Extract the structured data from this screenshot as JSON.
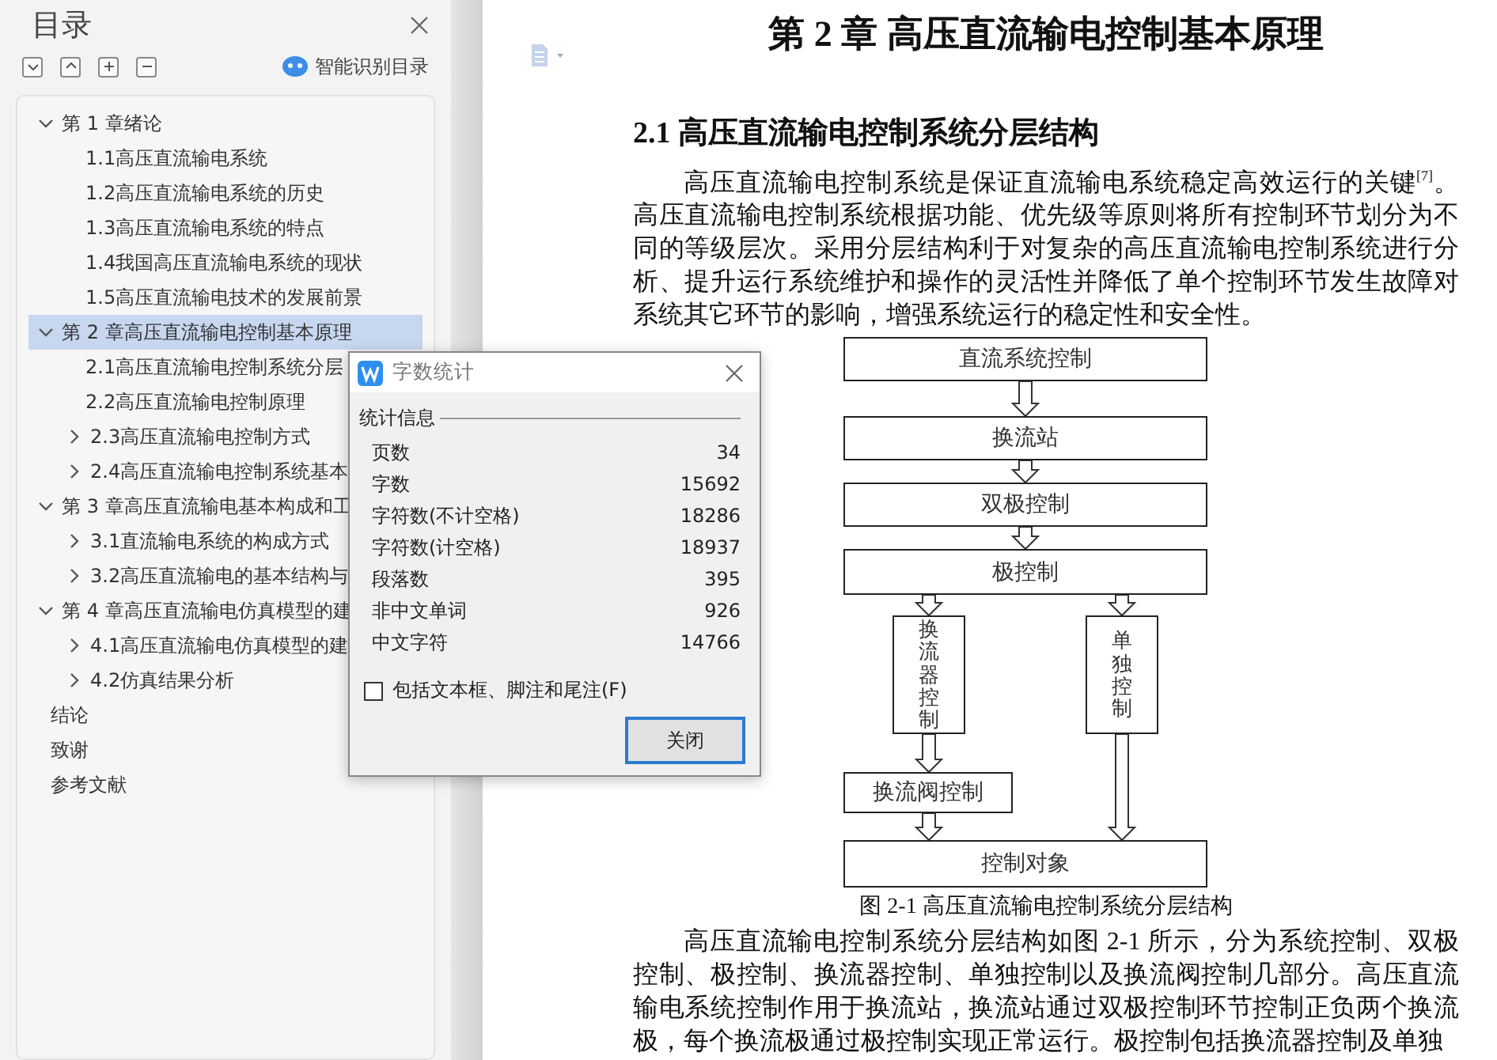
{
  "sidebar": {
    "title": "目录",
    "smart_toc_button": "智能识别目录",
    "toc": [
      {
        "label": "第 1 章绪论",
        "kind": "branch",
        "expanded": true,
        "selected": false,
        "children": [
          {
            "label": "1.1高压直流输电系统",
            "kind": "leaf",
            "selected": false
          },
          {
            "label": "1.2高压直流输电系统的历史",
            "kind": "leaf",
            "selected": false
          },
          {
            "label": "1.3高压直流输电系统的特点",
            "kind": "leaf",
            "selected": false
          },
          {
            "label": "1.4我国高压直流输电系统的现状",
            "kind": "leaf",
            "selected": false
          },
          {
            "label": "1.5高压直流输电技术的发展前景",
            "kind": "leaf",
            "selected": false
          }
        ]
      },
      {
        "label": "第 2 章高压直流输电控制基本原理",
        "kind": "branch",
        "expanded": true,
        "selected": true,
        "children": [
          {
            "label": "2.1高压直流输电控制系统分层",
            "kind": "leaf",
            "selected": false
          },
          {
            "label": "2.2高压直流输电控制原理",
            "kind": "leaf",
            "selected": false
          },
          {
            "label": "2.3高压直流输电控制方式",
            "kind": "branch",
            "expanded": false,
            "selected": false
          },
          {
            "label": "2.4高压直流输电控制系统基本",
            "kind": "branch",
            "expanded": false,
            "selected": false
          }
        ]
      },
      {
        "label": "第 3 章高压直流输电基本构成和工",
        "kind": "branch",
        "expanded": true,
        "selected": false,
        "children": [
          {
            "label": "3.1直流输电系统的构成方式",
            "kind": "branch",
            "expanded": false,
            "selected": false
          },
          {
            "label": "3.2高压直流输电的基本结构与",
            "kind": "branch",
            "expanded": false,
            "selected": false
          }
        ]
      },
      {
        "label": "第 4 章高压直流输电仿真模型的建",
        "kind": "branch",
        "expanded": true,
        "selected": false,
        "children": [
          {
            "label": "4.1高压直流输电仿真模型的建",
            "kind": "branch",
            "expanded": false,
            "selected": false
          },
          {
            "label": "4.2仿真结果分析",
            "kind": "branch",
            "expanded": false,
            "selected": false
          }
        ]
      },
      {
        "label": "结论",
        "kind": "leaf",
        "selected": false
      },
      {
        "label": "致谢",
        "kind": "leaf",
        "selected": false
      },
      {
        "label": "参考文献",
        "kind": "leaf",
        "selected": false
      }
    ]
  },
  "document": {
    "heading": "第 2 章  高压直流输电控制基本原理",
    "section_heading": "2.1  高压直流输电控制系统分层结构",
    "paragraphs": [
      "高压直流输电控制系统是保证直流输电系统稳定高效运行的关键$^{[7]}$。高压直流输电控制系统根据功能、优先级等原则将所有控制环节划分为不同的等级层次。采用分层结构利于对复杂的高压直流输电控制系统进行分析、提升运行系统维护和操作的灵活性并降低了单个控制环节发生故障对系统其它环节的影响，增强系统运行的稳定性和安全性。"
    ],
    "figure": {
      "nodes": [
        {
          "label": "直流系统控制",
          "kind": "horizontal"
        },
        {
          "label": "换流站",
          "kind": "horizontal"
        },
        {
          "label": "双极控制",
          "kind": "horizontal"
        },
        {
          "label": "极控制",
          "kind": "horizontal"
        },
        {
          "label": "换流器控制",
          "kind": "vertical"
        },
        {
          "label": "单独控制",
          "kind": "vertical"
        },
        {
          "label": "换流阀控制",
          "kind": "horizontal"
        },
        {
          "label": "控制对象",
          "kind": "horizontal"
        }
      ],
      "caption": "图 2-1  高压直流输电控制系统分层结构"
    },
    "paragraphs_after": [
      "高压直流输电控制系统分层结构如图 2-1 所示，分为系统控制、双极控制、极控制、换流器控制、单独控制以及换流阀控制几部分。高压直流输电系统控制作用于换流站，换流站通过双极控制环节控制正负两个换流极，每个换流极通过极控制实现正常运行。极控制包括换流器控制及单独"
    ]
  },
  "dialog": {
    "title": "字数统计",
    "group_label": "统计信息",
    "stats": [
      {
        "label": "页数",
        "value": "34"
      },
      {
        "label": "字数",
        "value": "15692"
      },
      {
        "label": "字符数(不计空格)",
        "value": "18286"
      },
      {
        "label": "字符数(计空格)",
        "value": "18937"
      },
      {
        "label": "段落数",
        "value": "395"
      },
      {
        "label": "非中文单词",
        "value": "926"
      },
      {
        "label": "中文字符",
        "value": "14766"
      }
    ],
    "include_checkbox": {
      "label": "包括文本框、脚注和尾注(F)",
      "checked": false
    },
    "close_button": "关闭"
  }
}
